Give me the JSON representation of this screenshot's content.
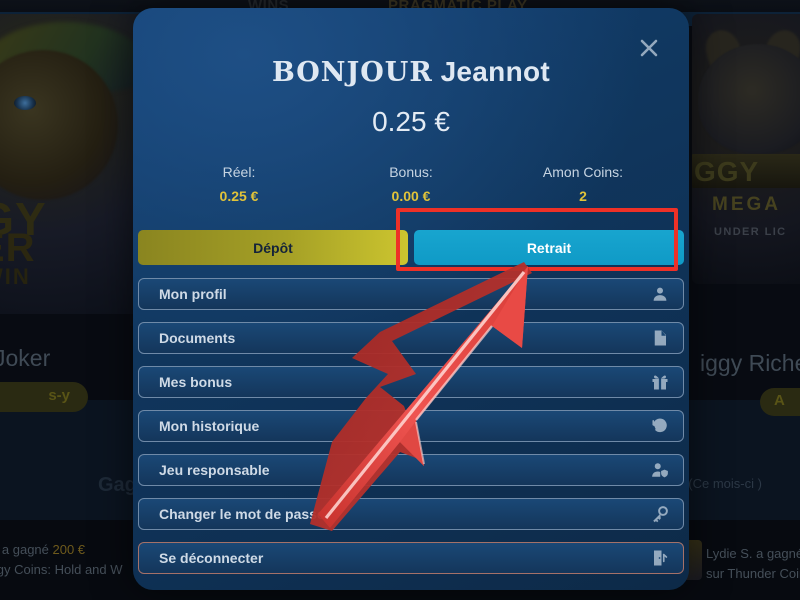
{
  "background": {
    "topbar": {
      "left_text": "WINS",
      "right_text": "PRAGMATIC PLAY"
    },
    "left_tile": {
      "logo_line1": "RGY",
      "logo_line2": "KER",
      "logo_line3": "D WIN",
      "game_title": "Joker",
      "play_button": "s-y"
    },
    "right_tile": {
      "logo_text": "GGY",
      "mega_text": "MEGA",
      "license_text": "UNDER LIC",
      "game_title": "iggy Riche",
      "play_button": "A"
    },
    "winners_heading": "Gagn",
    "period_label": "S (Ce mois-ci )",
    "ticker": {
      "left_line1_prefix": "S. a gagné ",
      "left_line1_amount": "200 €",
      "left_line2": "nergy Coins: Hold and W",
      "right_line1": "Lydie S. a gagné",
      "right_line2": "sur Thunder Coin"
    }
  },
  "modal": {
    "close_icon": "close-icon",
    "greeting_prefix": "BONJOUR",
    "username": "Jeannot",
    "total_balance": "0.25 €",
    "stats": [
      {
        "label": "Réel:",
        "value": "0.25 €"
      },
      {
        "label": "Bonus:",
        "value": "0.00 €"
      },
      {
        "label": "Amon Coins:",
        "value": "2"
      }
    ],
    "payment_buttons": {
      "deposit_label": "Dépôt",
      "withdraw_label": "Retrait"
    },
    "menu_items": [
      {
        "label": "Mon profil",
        "icon": "person-icon"
      },
      {
        "label": "Documents",
        "icon": "document-icon"
      },
      {
        "label": "Mes bonus",
        "icon": "gift-icon"
      },
      {
        "label": "Mon historique",
        "icon": "history-icon"
      },
      {
        "label": "Jeu responsable",
        "icon": "person-shield-icon"
      },
      {
        "label": "Changer le mot de passe",
        "icon": "key-icon"
      },
      {
        "label": "Se déconnecter",
        "icon": "logout-icon"
      }
    ]
  },
  "annotations": {
    "highlight_box_color": "#ee3127",
    "arrow_color": "#e8403c",
    "arrow_target": "Retrait"
  },
  "colors": {
    "panel_blue": "#123f72",
    "accent_gold": "#e0c33a",
    "withdraw_cyan": "#12a0ca",
    "deposit_olive": "#a5a026",
    "logout_border": "#a57168"
  }
}
